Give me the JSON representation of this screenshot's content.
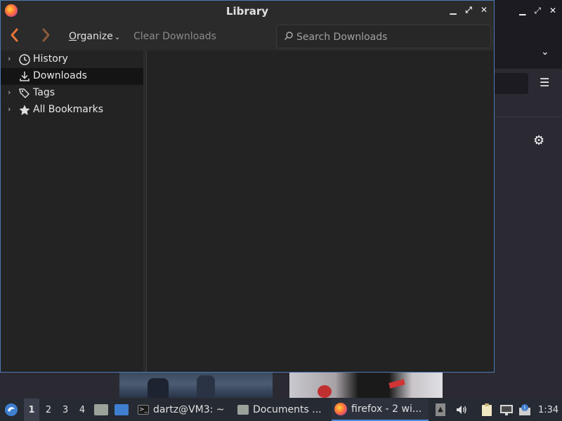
{
  "window": {
    "title": "Library",
    "controls": {
      "minimize": "▁",
      "maximize": "⤢",
      "close": "✕"
    }
  },
  "toolbar": {
    "back_icon": "chevron-left",
    "forward_icon": "chevron-right",
    "organize_label_u": "O",
    "organize_label_rest": "rganize",
    "clear_label": "Clear Downloads",
    "search_placeholder": "Search Downloads"
  },
  "sidebar": {
    "items": [
      {
        "label": "History",
        "icon": "clock-icon",
        "expandable": true,
        "selected": false
      },
      {
        "label": "Downloads",
        "icon": "download-icon",
        "expandable": false,
        "selected": true
      },
      {
        "label": "Tags",
        "icon": "tags-icon",
        "expandable": true,
        "selected": false
      },
      {
        "label": "All Bookmarks",
        "icon": "star-icon",
        "expandable": true,
        "selected": false
      }
    ]
  },
  "taskbar": {
    "workspaces": [
      "1",
      "2",
      "3",
      "4"
    ],
    "active_workspace": "1",
    "tasks": [
      {
        "label": "dartz@VM3: ~",
        "icon": "terminal-icon"
      },
      {
        "label": "Documents ...",
        "icon": "folder-icon"
      },
      {
        "label": "firefox - 2 wi...",
        "icon": "firefox-icon",
        "active": true
      }
    ],
    "clock": "1:34"
  },
  "colors": {
    "accent": "#4f8ad9",
    "window_border": "#4b7bb3",
    "back_arrow": "#e8753a",
    "forward_arrow": "#8b5a3a",
    "selected_row": "#141414"
  }
}
